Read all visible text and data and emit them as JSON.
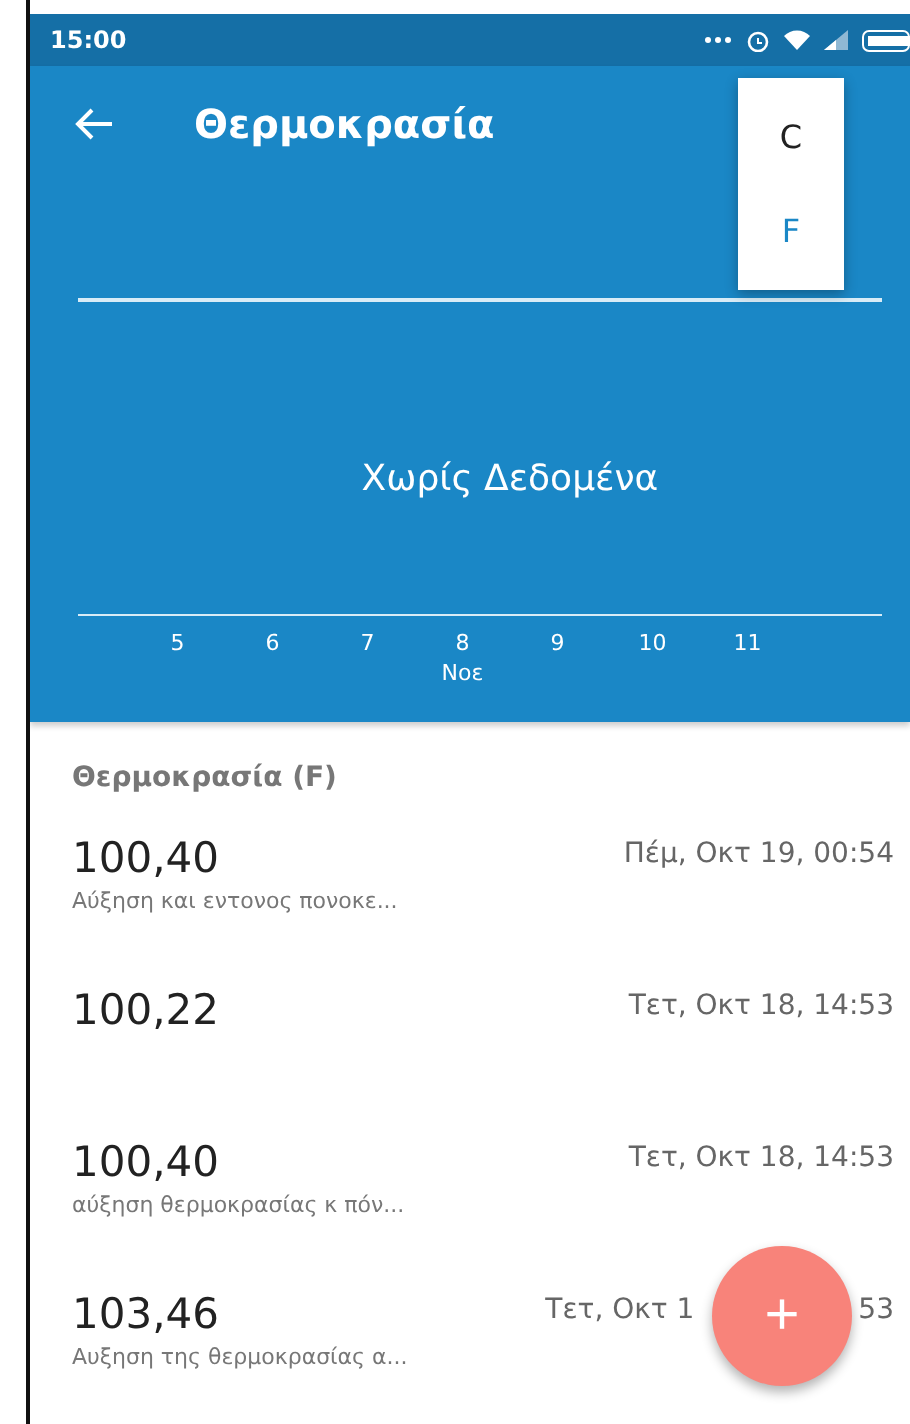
{
  "status_bar": {
    "time": "15:00"
  },
  "toolbar": {
    "title": "Θερμοκρασία"
  },
  "chart": {
    "empty_message": "Χωρίς Δεδομένα",
    "x_ticks": [
      "5",
      "6",
      "7",
      "8",
      "9",
      "10",
      "11"
    ],
    "month_label": "Νοε"
  },
  "unit_menu": [
    {
      "label": "C",
      "selected": false
    },
    {
      "label": "F",
      "selected": true
    }
  ],
  "list_header": "Θερμοκρασία (F)",
  "readings": [
    {
      "value": "100,40",
      "note": "Αύξηση και εντονος πονοκε...",
      "date_parts": [
        "Πέμ, Οκτ 19, 00:54"
      ]
    },
    {
      "value": "100,22",
      "date_parts": [
        "Τετ, Οκτ 18, 14:53"
      ]
    },
    {
      "value": "100,40",
      "note": "αύξηση θερμοκρασίας κ πόν...",
      "date_parts": [
        "Τετ, Οκτ 18, 14:53"
      ]
    },
    {
      "value": "103,46",
      "note": "Αυξηση της θερμοκρασίας α...",
      "date_parts": [
        "Τετ, Οκτ 1",
        "53"
      ]
    }
  ],
  "fab": {
    "label": "+"
  }
}
